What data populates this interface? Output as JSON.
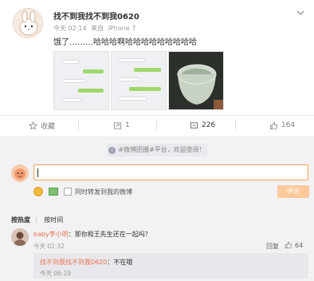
{
  "post": {
    "author": "找不到我找不到我0620",
    "time": "今天 02:14",
    "source_prefix": "来自",
    "source": "iPhone 7",
    "text": "饿了………哈哈哈啊哈哈哈哈哈哈哈哈哈"
  },
  "actions": {
    "favorite": "收藏",
    "repost": "1",
    "comments": "226",
    "likes": "164"
  },
  "comment_box": {
    "notice": "#微博团播#平台，欢迎查阅！",
    "repost_checkbox_label": "同时转发到我的微博",
    "submit_label": "评论"
  },
  "sort": {
    "by_heat": "按热度",
    "divider": "|",
    "by_time": "按时间"
  },
  "comments": [
    {
      "user": "baby李小明",
      "text": "：那你和王先生还在一起吗？",
      "time": "今天 02:32",
      "reply_label": "回复",
      "likes": "64",
      "replies": [
        {
          "user": "找不到我找不到我0620",
          "text": "：不在哦",
          "time": "今天 06:19"
        }
      ]
    }
  ],
  "icons": {
    "favorite": "star-icon",
    "repost": "repost-icon",
    "comment": "comment-icon",
    "like": "thumbs-up-icon",
    "more": "chevron-down-icon"
  },
  "colors": {
    "accent": "#f0a155",
    "username": "#eb7350",
    "submit_disabled": "#ffc99a"
  }
}
